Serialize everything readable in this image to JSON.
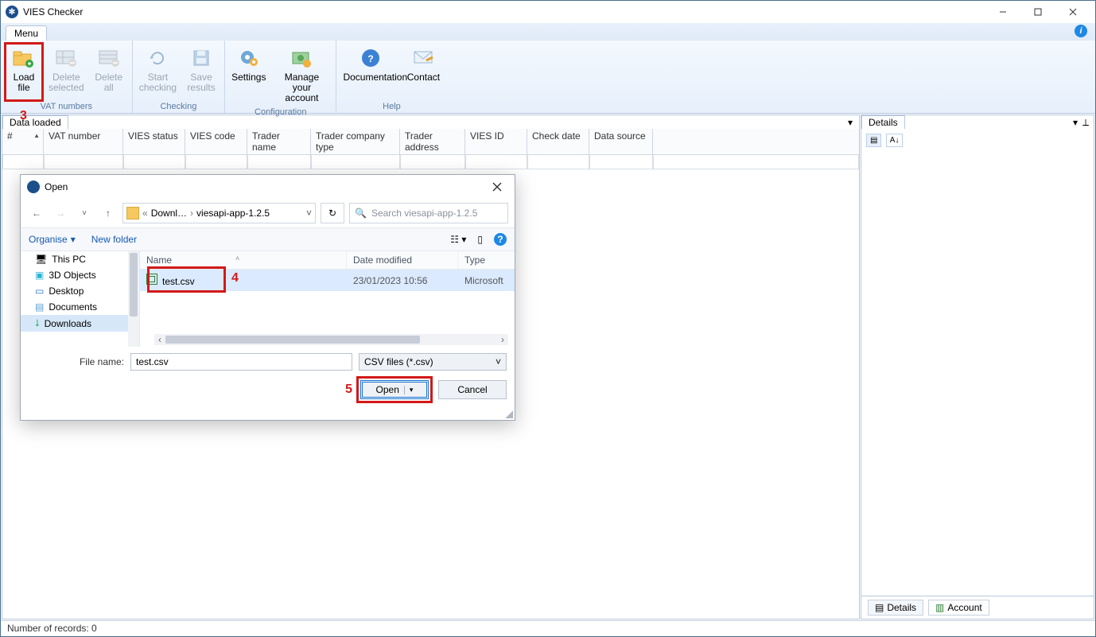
{
  "app": {
    "title": "VIES Checker"
  },
  "menu": {
    "tab": "Menu"
  },
  "ribbon": {
    "groups": [
      {
        "label": "VAT numbers",
        "items": [
          {
            "key": "load",
            "l1": "Load",
            "l2": "file"
          },
          {
            "key": "delsel",
            "l1": "Delete",
            "l2": "selected"
          },
          {
            "key": "delall",
            "l1": "Delete",
            "l2": "all"
          }
        ]
      },
      {
        "label": "Checking",
        "items": [
          {
            "key": "start",
            "l1": "Start",
            "l2": "checking"
          },
          {
            "key": "save",
            "l1": "Save",
            "l2": "results"
          }
        ]
      },
      {
        "label": "Configuration",
        "items": [
          {
            "key": "settings",
            "l1": "Settings",
            "l2": ""
          },
          {
            "key": "manage",
            "l1": "Manage your",
            "l2": "account"
          }
        ]
      },
      {
        "label": "Help",
        "items": [
          {
            "key": "doc",
            "l1": "Documentation",
            "l2": ""
          },
          {
            "key": "contact",
            "l1": "Contact",
            "l2": ""
          }
        ]
      }
    ]
  },
  "dataPanel": {
    "title": "Data loaded",
    "columns": [
      "#",
      "VAT number",
      "VIES status",
      "VIES code",
      "Trader name",
      "Trader company type",
      "Trader address",
      "VIES ID",
      "Check date",
      "Data source"
    ]
  },
  "details": {
    "title": "Details",
    "tab1": "Details",
    "tab2": "Account"
  },
  "status": {
    "text": "Number of records: 0"
  },
  "dialog": {
    "title": "Open",
    "crumb1": "Downl…",
    "crumb2": "viesapi-app-1.2.5",
    "searchPlaceholder": "Search viesapi-app-1.2.5",
    "organise": "Organise",
    "newFolder": "New folder",
    "tree": [
      "This PC",
      "3D Objects",
      "Desktop",
      "Documents",
      "Downloads"
    ],
    "listHeaders": {
      "name": "Name",
      "date": "Date modified",
      "type": "Type"
    },
    "file": {
      "name": "test.csv",
      "date": "23/01/2023 10:56",
      "type": "Microsoft"
    },
    "fileNameLabel": "File name:",
    "fileNameValue": "test.csv",
    "filter": "CSV files (*.csv)",
    "openBtn": "Open",
    "cancelBtn": "Cancel"
  },
  "annotations": {
    "a3": "3",
    "a4": "4",
    "a5": "5"
  }
}
